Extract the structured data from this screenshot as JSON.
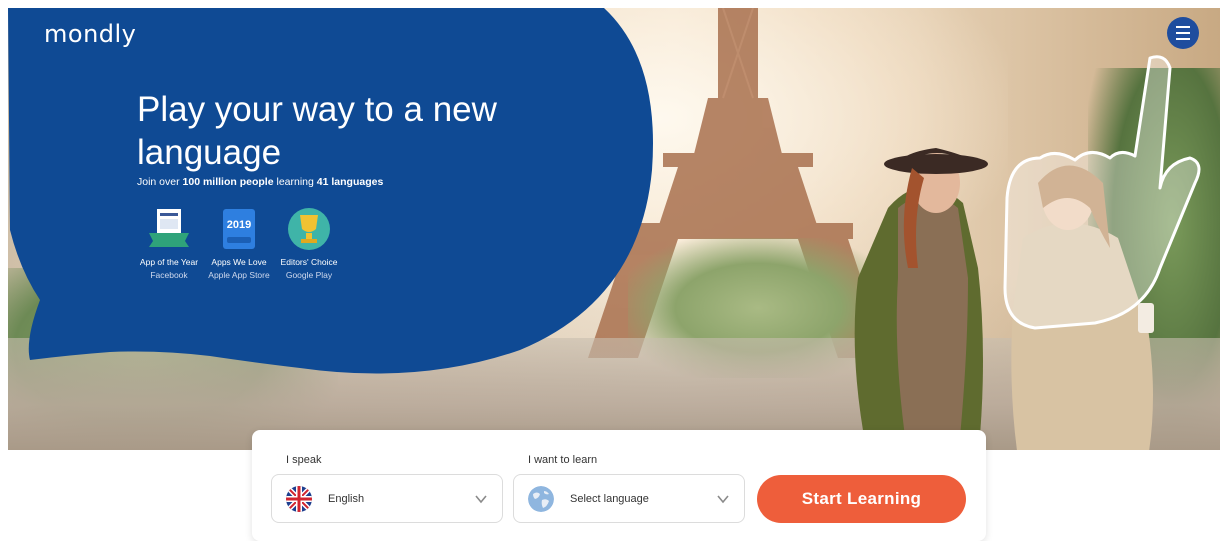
{
  "brand": {
    "logo_text": "mondly"
  },
  "hero": {
    "headline": "Play your way to a new language",
    "subline_prefix": "Join over ",
    "subline_users": "100 million people",
    "subline_middle": " learning ",
    "subline_langs": "41 languages"
  },
  "awards": [
    {
      "badge_icon": "facebook-award-icon",
      "badge_text": "",
      "title": "App of the Year",
      "source": "Facebook"
    },
    {
      "badge_icon": "apple-best-of-2019-icon",
      "badge_text": "2019",
      "title": "Apps We Love",
      "source": "Apple App Store"
    },
    {
      "badge_icon": "google-trophy-icon",
      "badge_text": "",
      "title": "Editors' Choice",
      "source": "Google Play"
    }
  ],
  "form": {
    "speak_label": "I speak",
    "speak_value": "English",
    "learn_label": "I want to learn",
    "learn_value": "Select language",
    "start_label": "Start Learning"
  },
  "colors": {
    "brand_blue": "#0f4a94",
    "menu_blue": "#1e4d9e",
    "cta_orange": "#ee5e3b"
  }
}
